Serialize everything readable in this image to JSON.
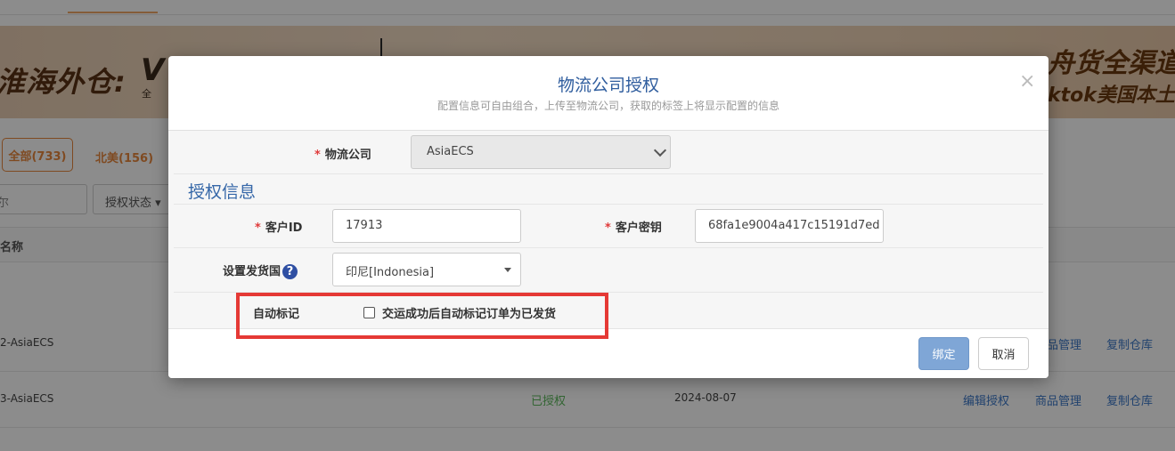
{
  "banner": {
    "left_text": "淮海外仓:",
    "logo_sub": "全",
    "right_text": "舟货全渠道发货",
    "right_sub": "ktok美国本土"
  },
  "filters": {
    "all_label": "全部(733)",
    "na_label": "北美(156)",
    "search_placeholder": "尔",
    "status_select": "授权状态"
  },
  "list": {
    "header_name": "名称",
    "rows": [
      {
        "name": "2-AsiaECS",
        "status": "",
        "date": "",
        "ops": [
          "",
          "品管理",
          "复制仓库"
        ]
      },
      {
        "name": "3-AsiaECS",
        "status": "已授权",
        "date": "2024-08-07",
        "ops": [
          "编辑授权",
          "商品管理",
          "复制仓库"
        ]
      }
    ]
  },
  "modal": {
    "title": "物流公司授权",
    "subtitle": "配置信息可自由组合，上传至物流公司，获取的标签上将显示配置的信息",
    "close": "×",
    "carrier_label": "物流公司",
    "carrier_value": "AsiaECS",
    "section_title": "授权信息",
    "customer_id_label": "客户ID",
    "customer_id_value": "17913",
    "customer_key_label": "客户密钥",
    "customer_key_value": "68fa1e9004a417c15191d7ed",
    "country_label": "设置发货国",
    "country_help": "?",
    "country_value": "印尼[Indonesia]",
    "auto_mark_label": "自动标记",
    "auto_mark_checkbox_label": "交运成功后自动标记订单为已发货",
    "auto_mark_checked": false,
    "bind_button": "绑定",
    "cancel_button": "取消"
  },
  "colors": {
    "accent_orange": "#e8873c",
    "title_blue": "#2f5d9e",
    "primary_button": "#7fa6d6",
    "highlight_red": "#e53935",
    "status_green": "#5cb85c",
    "link_blue": "#3c78c8"
  }
}
